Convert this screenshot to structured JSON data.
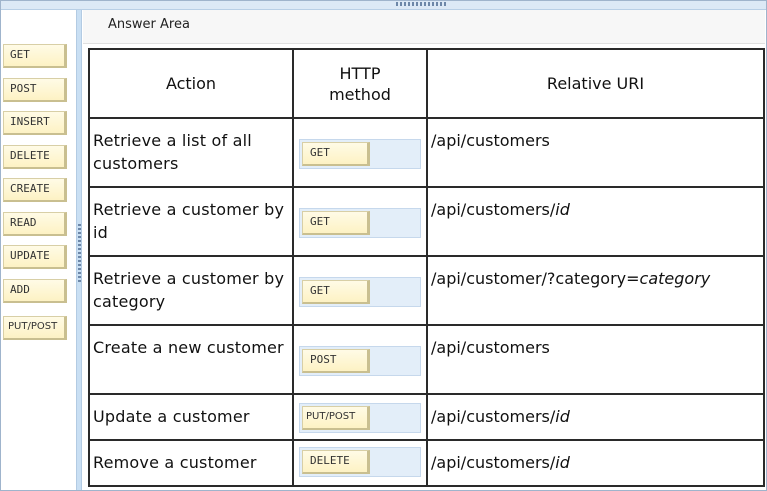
{
  "answer_area": {
    "title": "Answer Area",
    "columns": [
      "Action",
      "HTTP method",
      "Relative URI"
    ],
    "rows": [
      {
        "action": "Retrieve a list of all customers",
        "method": "GET",
        "uri_base": "/api/customers",
        "uri_param": ""
      },
      {
        "action": "Retrieve a customer by id",
        "method": "GET",
        "uri_base": "/api/customers/",
        "uri_param": "id"
      },
      {
        "action": "Retrieve a customer by category",
        "method": "GET",
        "uri_base": "/api/customer/?category=",
        "uri_param": "category"
      },
      {
        "action": "Create a new customer",
        "method": "POST",
        "uri_base": "/api/customers",
        "uri_param": ""
      },
      {
        "action": "Update a customer",
        "method": "PUT/POST",
        "uri_base": "/api/customers/",
        "uri_param": "id"
      },
      {
        "action": "Remove a customer",
        "method": "DELETE",
        "uri_base": "/api/customers/",
        "uri_param": "id"
      }
    ]
  },
  "source_items": [
    "GET",
    "POST",
    "INSERT",
    "DELETE",
    "CREATE",
    "READ",
    "UPDATE",
    "ADD",
    "PUT/POST"
  ]
}
